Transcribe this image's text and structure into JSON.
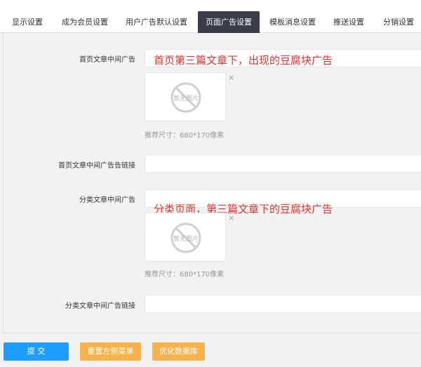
{
  "tabs": [
    {
      "label": "显示设置"
    },
    {
      "label": "成为会员设置"
    },
    {
      "label": "用户广告默认设置"
    },
    {
      "label": "页面广告设置",
      "active": true
    },
    {
      "label": "模板消息设置"
    },
    {
      "label": "推送设置"
    },
    {
      "label": "分销设置"
    }
  ],
  "form": {
    "home_ad": {
      "label": "首页文章中间广告",
      "annotation": "首页第三篇文章下，出现的豆腐块广告",
      "image_placeholder": "暂无图片",
      "close_symbol": "×",
      "hint": "推荐尺寸：680*170像素"
    },
    "home_ad_link": {
      "label": "首页文章中间广告告链接",
      "value": ""
    },
    "category_ad": {
      "label": "分类文章中间广告",
      "annotation": "分类页面，第三篇文章下的豆腐块广告",
      "image_placeholder": "暂无图片",
      "close_symbol": "×",
      "hint": "推荐尺寸：680*170像素"
    },
    "category_ad_link": {
      "label": "分类文章中间广告链接",
      "value": ""
    }
  },
  "actions": {
    "submit": "提 交",
    "reset_menu": "重置左侧菜单",
    "optimize_db": "优化数据库"
  },
  "colors": {
    "active_tab": "#393d49",
    "primary": "#1e9fff",
    "warm": "#f7b24c",
    "annotation": "#e8312a"
  }
}
